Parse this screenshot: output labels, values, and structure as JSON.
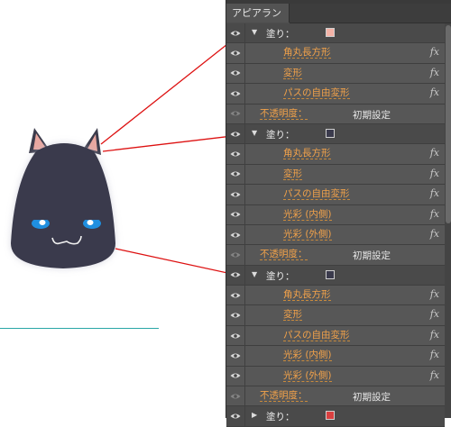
{
  "panel": {
    "tab_label": "アピアランス"
  },
  "groups": [
    {
      "label": "塗り：",
      "swatch_color": "#f4b3a7",
      "effects": [
        "角丸長方形",
        "変形",
        "パスの自由変形"
      ],
      "opacity_label": "不透明度：",
      "opacity_value": "初期設定"
    },
    {
      "label": "塗り：",
      "swatch_color": "#3a3a4c",
      "effects": [
        "角丸長方形",
        "変形",
        "パスの自由変形",
        "光彩 (内側)",
        "光彩 (外側)"
      ],
      "opacity_label": "不透明度：",
      "opacity_value": "初期設定"
    },
    {
      "label": "塗り：",
      "swatch_color": "#3a3a4c",
      "effects": [
        "角丸長方形",
        "変形",
        "パスの自由変形",
        "光彩 (内側)",
        "光彩 (外側)"
      ],
      "opacity_label": "不透明度：",
      "opacity_value": "初期設定"
    },
    {
      "label": "塗り：",
      "swatch_color": "#d94040",
      "effects": [],
      "opacity_label": "",
      "opacity_value": ""
    }
  ],
  "fx_symbol": "fx",
  "colors": {
    "effect_text": "#f2a24a",
    "leader_line": "#dd1111",
    "guide_line": "#2aa6a6"
  }
}
